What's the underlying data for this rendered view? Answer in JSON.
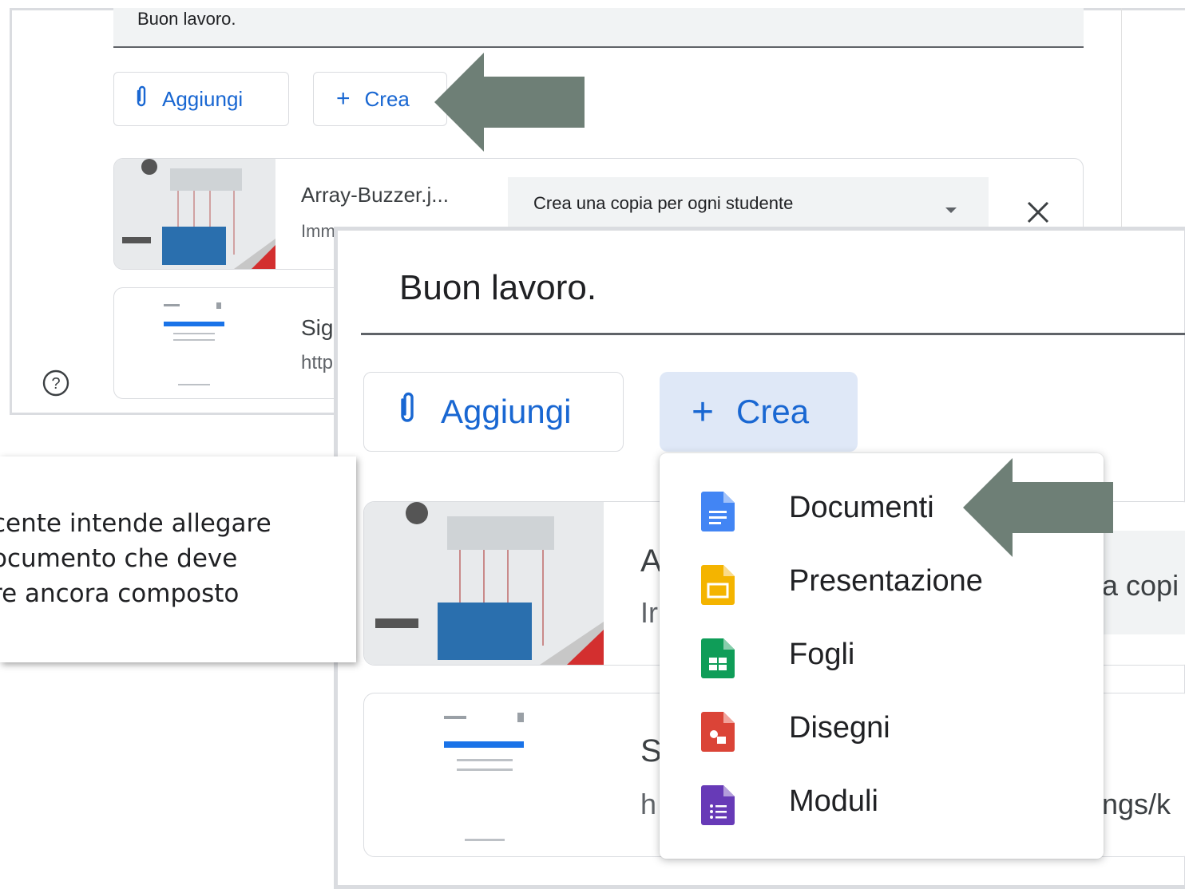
{
  "background_view": {
    "description_text": "Buon lavoro.",
    "add_button": "Aggiungi",
    "create_button": "Crea",
    "attachments": [
      {
        "title": "Array-Buzzer.j...",
        "subtitle": "Imm"
      },
      {
        "title": "Sig",
        "subtitle": "http"
      }
    ],
    "share_select": "Crea una copia per ogni studente"
  },
  "zoomed_view": {
    "description_text": "Buon lavoro.",
    "add_button": "Aggiungi",
    "create_button": "Crea",
    "attachments": [
      {
        "title": "A",
        "subtitle": "Ir",
        "select_fragment": "a copi"
      },
      {
        "title": "S",
        "subtitle": "h",
        "link_fragment": "ngs/k"
      }
    ],
    "create_menu": [
      {
        "label": "Documenti",
        "icon": "docs-icon",
        "color": "#4285f4"
      },
      {
        "label": "Presentazione",
        "icon": "slides-icon",
        "color": "#f4b400"
      },
      {
        "label": "Fogli",
        "icon": "sheets-icon",
        "color": "#0f9d58"
      },
      {
        "label": "Disegni",
        "icon": "drawings-icon",
        "color": "#db4437"
      },
      {
        "label": "Moduli",
        "icon": "forms-icon",
        "color": "#673ab7"
      }
    ]
  },
  "callout": {
    "lines": [
      "cente intende allegare",
      "ocumento che deve",
      "re ancora composto"
    ]
  },
  "colors": {
    "accent_blue": "#1967d2",
    "arrow": "#6e7f76",
    "crea_highlight": "#dfe8f7"
  }
}
